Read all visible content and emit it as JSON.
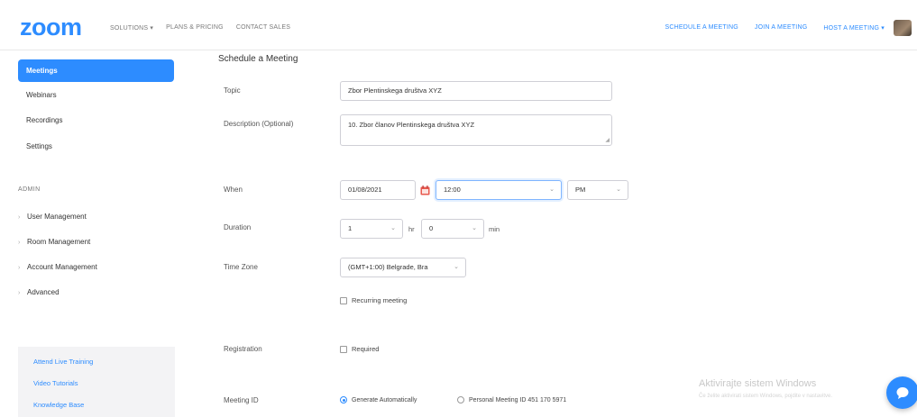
{
  "header": {
    "logo": "zoom",
    "nav_left": [
      "SOLUTIONS ▾",
      "PLANS & PRICING",
      "CONTACT SALES"
    ],
    "nav_right": [
      "SCHEDULE A MEETING",
      "JOIN A MEETING",
      "HOST A MEETING ▾"
    ]
  },
  "sidebar": {
    "items": [
      {
        "label": "Meetings",
        "active": true
      },
      {
        "label": "Webinars"
      },
      {
        "label": "Recordings"
      },
      {
        "label": "Settings"
      }
    ],
    "admin_label": "ADMIN",
    "admin_items": [
      "User Management",
      "Room Management",
      "Account Management",
      "Advanced"
    ],
    "help_links": [
      "Attend Live Training",
      "Video Tutorials",
      "Knowledge Base"
    ]
  },
  "form": {
    "title": "Schedule a Meeting",
    "topic_label": "Topic",
    "topic_value": "Zbor Plentinskega društva XYZ",
    "description_label": "Description (Optional)",
    "description_value": "10. Zbor članov Plentinskega društva XYZ",
    "when_label": "When",
    "date_value": "01/08/2021",
    "time_value": "12:00",
    "ampm_value": "PM",
    "duration_label": "Duration",
    "duration_hours": "1",
    "duration_hr_unit": "hr",
    "duration_minutes": "0",
    "duration_min_unit": "min",
    "timezone_label": "Time Zone",
    "timezone_value": "(GMT+1:00) Belgrade, Bra",
    "recurring_label": "Recurring meeting",
    "registration_label": "Registration",
    "registration_required": "Required",
    "meeting_id_label": "Meeting ID",
    "meeting_id_auto": "Generate Automatically",
    "meeting_id_personal": "Personal Meeting ID 451 170 5971"
  },
  "watermark": {
    "title": "Aktivirajte sistem Windows",
    "subtitle": "Če želite aktivirati sistem Windows, pojdite v nastavitve."
  },
  "colors": {
    "accent": "#2D8CFF"
  }
}
